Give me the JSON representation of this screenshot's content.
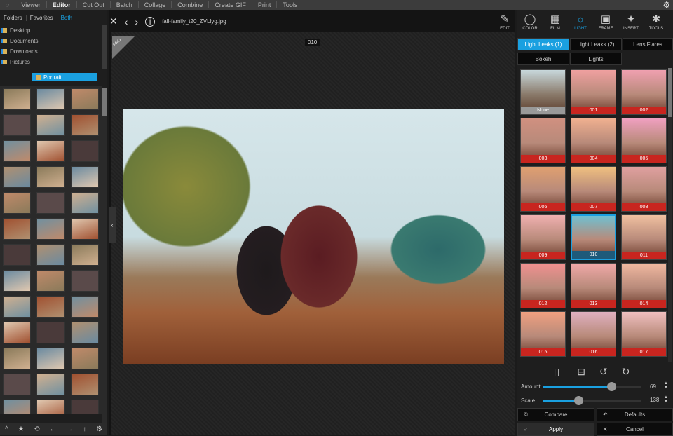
{
  "menu": {
    "items": [
      "Viewer",
      "Editor",
      "Cut Out",
      "Batch",
      "Collage",
      "Combine",
      "Create GIF",
      "Print",
      "Tools"
    ],
    "active": "Editor"
  },
  "left": {
    "tabs": [
      "Folders",
      "Favorites",
      "Both"
    ],
    "active_tab": "Both",
    "folders": [
      "Desktop",
      "Documents",
      "Downloads",
      "Pictures"
    ],
    "selected_folder": "Portrait"
  },
  "viewer": {
    "filename": "fall-family_t20_ZVLlyg.jpg",
    "effect_badge": "010",
    "pro_badge": "PRO"
  },
  "tools": [
    {
      "label": "EDIT",
      "icon": "✎"
    },
    {
      "label": "COLOR",
      "icon": "◯"
    },
    {
      "label": "FILM",
      "icon": "▦"
    },
    {
      "label": "LIGHT",
      "icon": "☼"
    },
    {
      "label": "FRAME",
      "icon": "▣"
    },
    {
      "label": "INSERT",
      "icon": "✦"
    },
    {
      "label": "TOOLS",
      "icon": "✱"
    }
  ],
  "active_tool": "LIGHT",
  "effect_tabs": [
    "Light Leaks (1)",
    "Light Leaks (2)",
    "Lens Flares",
    "Bokeh",
    "Lights"
  ],
  "active_effect_tab": "Light Leaks (1)",
  "effects": [
    "None",
    "001",
    "002",
    "003",
    "004",
    "005",
    "006",
    "007",
    "008",
    "009",
    "010",
    "011",
    "012",
    "013",
    "014",
    "015",
    "016",
    "017"
  ],
  "selected_effect": "010",
  "sliders": {
    "amount": {
      "label": "Amount",
      "value": 69,
      "fraction": 0.69
    },
    "scale": {
      "label": "Scale",
      "value": 138,
      "fraction": 0.36
    }
  },
  "buttons": {
    "compare": "Compare",
    "defaults": "Defaults",
    "apply": "Apply",
    "cancel": "Cancel"
  },
  "colors": {
    "accent": "#1aa0e0",
    "label_red": "#c8251f"
  }
}
